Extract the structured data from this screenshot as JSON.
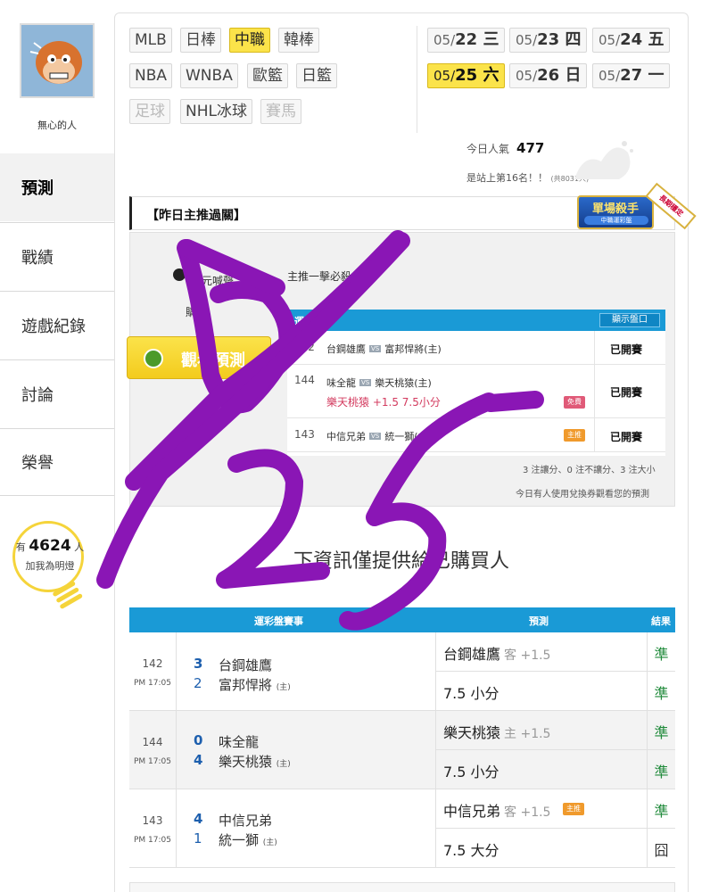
{
  "user": {
    "name": "無心的人",
    "fans_prefix": "有",
    "fans_count": "4624",
    "fans_suffix": "人",
    "fans_action": "加我為明燈"
  },
  "nav": [
    {
      "label": "預測",
      "active": true
    },
    {
      "label": "戰績",
      "active": false
    },
    {
      "label": "遊戲紀錄",
      "active": false
    },
    {
      "label": "討論",
      "active": false
    },
    {
      "label": "榮譽",
      "active": false
    }
  ],
  "leagues": [
    "MLB",
    "日棒",
    "中職",
    "韓棒",
    "NBA",
    "WNBA",
    "歐籃",
    "日籃",
    "足球",
    "NHL冰球",
    "賽馬"
  ],
  "dates": [
    {
      "prefix": "05/",
      "day": "22 三"
    },
    {
      "prefix": "05/",
      "day": "23 四"
    },
    {
      "prefix": "05/",
      "day": "24 五"
    },
    {
      "prefix": "05/",
      "day": "25 六"
    },
    {
      "prefix": "05/",
      "day": "26 日"
    },
    {
      "prefix": "05/",
      "day": "27 一"
    }
  ],
  "popularity": {
    "label": "今日人氣",
    "value": "477",
    "rank_text": "是站上第16名！！",
    "rank_total": "(共8031人)"
  },
  "section_title": "【昨日主推過關】",
  "badge": {
    "title": "單場殺手",
    "subtitle": "中職運彩盤",
    "ribbon": "長期穩定"
  },
  "prediction_panel": {
    "left_line1": "元喊聲",
    "left_line2": "購買",
    "top_right": "主推一擊必殺",
    "button_label": "觀看預測",
    "table_title": "運彩盤",
    "show_odds_button": "顯示盤口",
    "rows": [
      {
        "no": "142",
        "away": "台鋼雄鷹",
        "vs": "VS",
        "home": "富邦悍將(主)",
        "pick": "",
        "tag": "",
        "status": "已開賽"
      },
      {
        "no": "144",
        "away": "味全龍",
        "vs": "VS",
        "home": "樂天桃猿(主)",
        "pick": "樂天桃猿 +1.5 7.5小分",
        "tag": "免費",
        "status": "已開賽"
      },
      {
        "no": "143",
        "away": "中信兄弟",
        "vs": "VS",
        "home": "統一獅(主)",
        "pick": "",
        "tag": "主推",
        "status": "已開賽"
      }
    ],
    "summary": "3 注讓分、0 注不讓分、3 注大小",
    "note": "今日有人使用兌換券觀看您的預測"
  },
  "info_line": "下資訊僅提供給已購買人",
  "results": {
    "headers": [
      "運彩盤賽事",
      "預測",
      "結果"
    ],
    "games": [
      {
        "no": "142",
        "time": "PM 17:05",
        "away_score": "3",
        "away": "台鋼雄鷹",
        "home_score": "2",
        "home": "富邦悍將",
        "home_tag": "(主)",
        "pick1": "台鋼雄鷹",
        "pick1_side": "客 +1.5",
        "pick1_tag": "",
        "result1": "準",
        "pick2": "7.5 小分",
        "result2": "準"
      },
      {
        "no": "144",
        "time": "PM 17:05",
        "away_score": "0",
        "away": "味全龍",
        "home_score": "4",
        "home": "樂天桃猿",
        "home_tag": "(主)",
        "pick1": "樂天桃猿",
        "pick1_side": "主 +1.5",
        "pick1_tag": "",
        "result1": "準",
        "pick2": "7.5 小分",
        "result2": "準"
      },
      {
        "no": "143",
        "time": "PM 17:05",
        "away_score": "4",
        "away": "中信兄弟",
        "home_score": "1",
        "home": "統一獅",
        "home_tag": "(主)",
        "pick1": "中信兄弟",
        "pick1_side": "客 +1.5",
        "pick1_tag": "主推",
        "result1": "準",
        "pick2": "7.5 大分",
        "result2": "囧"
      }
    ]
  },
  "colors": {
    "accent_blue": "#1a9ad6",
    "highlight_yellow": "#fbe34a",
    "win_green": "#1f8a3a",
    "pick_red": "#d33b5f",
    "scribble_purple": "#8a16b5"
  },
  "annotation": {
    "description": "handwritten purple '5/25'"
  }
}
